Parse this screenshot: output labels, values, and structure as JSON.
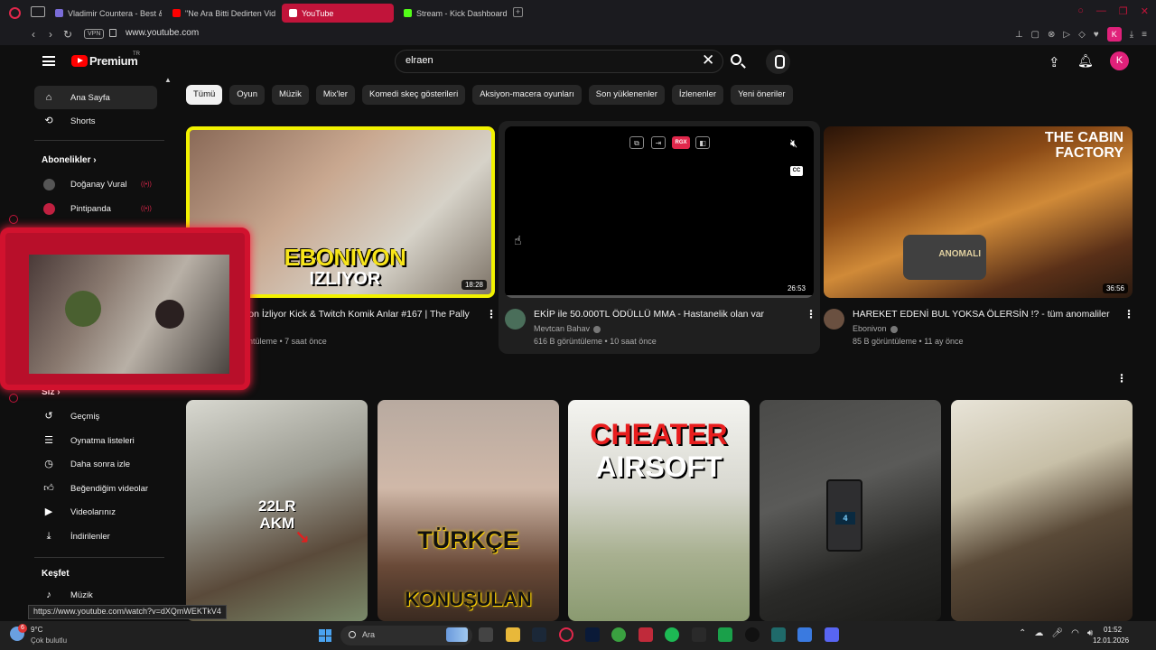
{
  "browser": {
    "tabs": [
      {
        "label": "Vladimir Countera - Best &",
        "color": "#7a6cd8"
      },
      {
        "label": "\"Ne Ara Bitti Dedirten Vid",
        "color": "#ff0000"
      },
      {
        "label": "YouTube",
        "color": "#ff0000"
      },
      {
        "label": "Stream - Kick Dashboard",
        "color": "#53fc18"
      }
    ],
    "vpn_label": "VPN",
    "url": "www.youtube.com",
    "profile_initial": "K"
  },
  "header": {
    "logo_text": "Premium",
    "logo_region": "TR",
    "search_query": "elraen",
    "avatar_initial": "K"
  },
  "sidebar": {
    "main": [
      {
        "label": "Ana Sayfa",
        "icon": "home-icon"
      },
      {
        "label": "Shorts",
        "icon": "shorts-icon"
      }
    ],
    "subscriptions_title": "Abonelikler",
    "subscriptions": [
      {
        "label": "Doğanay Vural",
        "color": "#555555"
      },
      {
        "label": "Pintipanda",
        "color": "#c02040"
      }
    ],
    "you_title": "Siz",
    "you_items": [
      {
        "label": "Geçmiş",
        "icon": "history-icon"
      },
      {
        "label": "Oynatma listeleri",
        "icon": "playlists-icon"
      },
      {
        "label": "Daha sonra izle",
        "icon": "watch-later-icon"
      },
      {
        "label": "Beğendiğim videolar",
        "icon": "like-icon"
      },
      {
        "label": "Videolarınız",
        "icon": "your-videos-icon"
      },
      {
        "label": "İndirilenler",
        "icon": "download-icon"
      }
    ],
    "explore_title": "Keşfet",
    "explore_items": [
      {
        "label": "Müzik",
        "icon": "music-icon"
      }
    ]
  },
  "chips": [
    "Tümü",
    "Oyun",
    "Müzik",
    "Mix'ler",
    "Komedi skeç gösterileri",
    "Aksiyon-macera oyunları",
    "Son yüklenenler",
    "İzlenenler",
    "Yeni öneriler"
  ],
  "videos": [
    {
      "title": "von İzliyor Kick & Twitch Komik Anlar #167 | The Pally",
      "channel": "",
      "meta": "üntüleme • 7 saat önce",
      "duration": "18:28",
      "thumb_text_1": "EBONIVON",
      "thumb_text_2": "IZLIYOR"
    },
    {
      "title": "EKİP ile 50.000TL ÖDÜLLÜ MMA - Hastanelik olan var",
      "channel": "Mevtcan Bahav",
      "meta": "616 B görüntüleme • 10 saat önce",
      "duration": "26:53",
      "preview_badge": "RGX"
    },
    {
      "title": "HAREKET EDENİ BUL YOKSA ÖLERSİN !? - tüm anomaliler",
      "channel": "Ebonivon",
      "meta": "85 B görüntüleme • 11 ay önce",
      "duration": "36:56",
      "thumb_text_1": "THE CABIN",
      "thumb_text_2": "FACTORY",
      "thumb_text_3": "ANOMALI"
    }
  ],
  "shorts": [
    {
      "text_1": "22LR",
      "text_2": "AKM"
    },
    {
      "text_1": "TÜRKÇE",
      "text_2": "KONUŞULAN"
    },
    {
      "text_1": "CHEATER",
      "text_2": "AIRSOFT"
    },
    {
      "text_1": "4"
    },
    {}
  ],
  "status_url": "https://www.youtube.com/watch?v=dXQmWEKTkV4",
  "taskbar": {
    "weather_temp": "9°C",
    "weather_desc": "Çok bulutlu",
    "weather_badge": "6",
    "search_placeholder": "Ara",
    "time": "01:52",
    "date": "12.01.2026"
  },
  "colors": {
    "accent": "#c1143a",
    "youtube_red": "#ff0000",
    "chip_bg": "#272727"
  }
}
